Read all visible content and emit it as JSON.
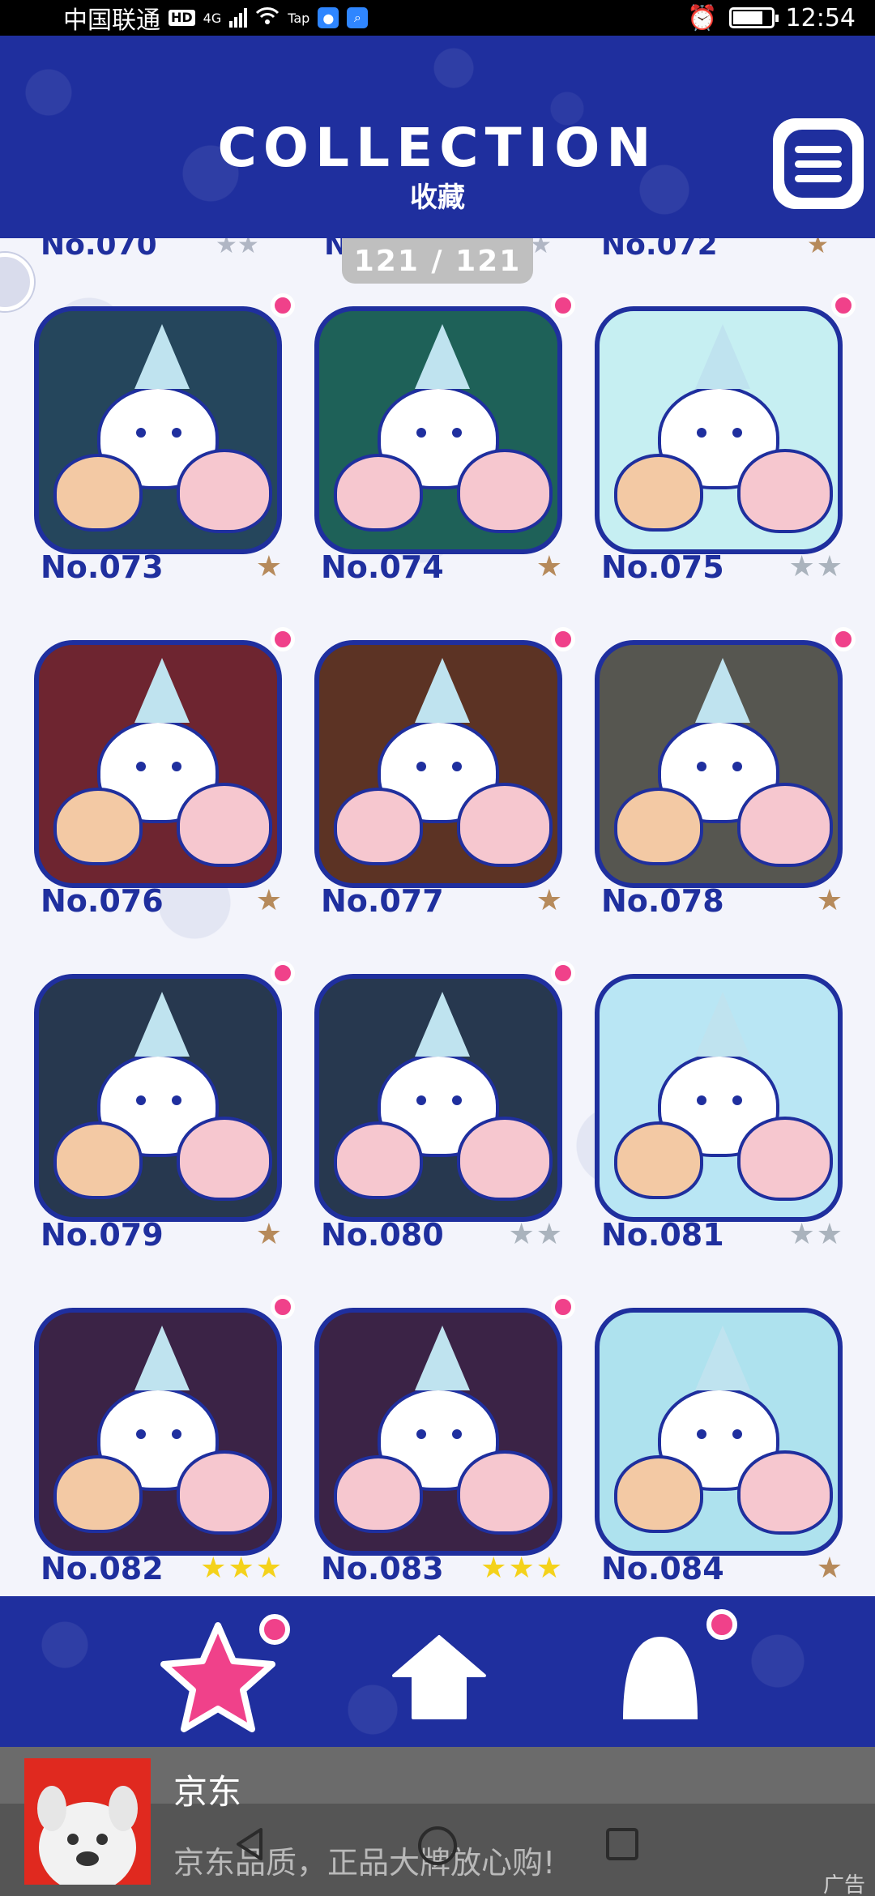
{
  "status_bar": {
    "carrier": "中国联通",
    "hd_badge": "HD",
    "network": "4G",
    "app_label": "Tap",
    "time": "12:54"
  },
  "header": {
    "title": "COLLECTION",
    "subtitle": "收藏"
  },
  "pager": {
    "counter": "121 / 121"
  },
  "partial_row": {
    "left": "No.070",
    "middle": "N",
    "right": "No.072"
  },
  "items": [
    {
      "number": "No.073",
      "stars": 1,
      "star_type": "bronze",
      "is_new": true,
      "bg": "#25465c"
    },
    {
      "number": "No.074",
      "stars": 1,
      "star_type": "bronze",
      "is_new": true,
      "bg": "#1e6158"
    },
    {
      "number": "No.075",
      "stars": 2,
      "star_type": "silver",
      "is_new": true,
      "bg": "#c6eff2"
    },
    {
      "number": "No.076",
      "stars": 1,
      "star_type": "bronze",
      "is_new": true,
      "bg": "#6e2530"
    },
    {
      "number": "No.077",
      "stars": 1,
      "star_type": "bronze",
      "is_new": true,
      "bg": "#5c3324"
    },
    {
      "number": "No.078",
      "stars": 1,
      "star_type": "bronze",
      "is_new": true,
      "bg": "#565650"
    },
    {
      "number": "No.079",
      "stars": 1,
      "star_type": "bronze",
      "is_new": true,
      "bg": "#27384f"
    },
    {
      "number": "No.080",
      "stars": 2,
      "star_type": "silver",
      "is_new": true,
      "bg": "#27384f"
    },
    {
      "number": "No.081",
      "stars": 2,
      "star_type": "silver",
      "is_new": false,
      "bg": "#b9e6f4"
    },
    {
      "number": "No.082",
      "stars": 3,
      "star_type": "gold",
      "is_new": true,
      "bg": "#3b2346"
    },
    {
      "number": "No.083",
      "stars": 3,
      "star_type": "gold",
      "is_new": true,
      "bg": "#3b2346"
    },
    {
      "number": "No.084",
      "stars": 1,
      "star_type": "bronze",
      "is_new": false,
      "bg": "#aee2ee"
    }
  ],
  "nav": {
    "star_color": "#f0418a",
    "dot_color": "#f0418a"
  },
  "ad": {
    "title": "京东",
    "description": "京东品质，正品大牌放心购!",
    "label": "广告"
  },
  "colors": {
    "brand_blue": "#1f2f9e",
    "accent_pink": "#f0418a"
  }
}
